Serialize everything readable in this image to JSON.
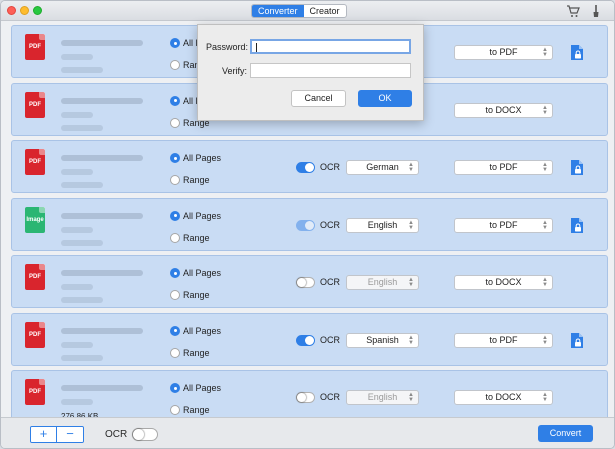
{
  "tabs": [
    {
      "label": "Converter",
      "active": true
    },
    {
      "label": "Creator",
      "active": false
    }
  ],
  "toolbar_icons": [
    "cart-icon",
    "brush-icon"
  ],
  "files": [
    {
      "type": "PDF",
      "size": "",
      "range_all": "All Pages",
      "range_custom": "Range",
      "ocr_visible": false,
      "ocr_on": false,
      "language": "",
      "output": "to PDF",
      "has_lock": true
    },
    {
      "type": "PDF",
      "size": "",
      "range_all": "All Pages",
      "range_custom": "Range",
      "ocr_visible": false,
      "ocr_on": false,
      "language": "",
      "output": "to DOCX",
      "has_lock": false
    },
    {
      "type": "PDF",
      "size": "",
      "range_all": "All Pages",
      "range_custom": "Range",
      "ocr_visible": true,
      "ocr_on": true,
      "language": "German",
      "output": "to PDF",
      "has_lock": true
    },
    {
      "type": "Image",
      "size": "",
      "range_all": "All Pages",
      "range_custom": "Range",
      "ocr_visible": true,
      "ocr_on": true,
      "ocr_dim": true,
      "language": "English",
      "output": "to PDF",
      "has_lock": true
    },
    {
      "type": "PDF",
      "size": "",
      "range_all": "All Pages",
      "range_custom": "Range",
      "ocr_visible": true,
      "ocr_on": false,
      "language": "English",
      "language_disabled": true,
      "output": "to DOCX",
      "has_lock": false
    },
    {
      "type": "PDF",
      "size": "",
      "range_all": "All Pages",
      "range_custom": "Range",
      "ocr_visible": true,
      "ocr_on": true,
      "language": "Spanish",
      "output": "to PDF",
      "has_lock": true
    },
    {
      "type": "PDF",
      "size": "276.86 KB",
      "range_all": "All Pages",
      "range_custom": "Range",
      "ocr_visible": true,
      "ocr_on": false,
      "language": "English",
      "language_disabled": true,
      "output": "to DOCX",
      "has_lock": false
    }
  ],
  "ocr_label": "OCR",
  "bottom": {
    "add": "+",
    "remove": "−",
    "ocr_label": "OCR",
    "ocr_on": false,
    "convert_label": "Convert"
  },
  "dialog": {
    "password_label": "Password:",
    "verify_label": "Verify:",
    "password_value": "",
    "verify_value": "",
    "cancel_label": "Cancel",
    "ok_label": "OK"
  },
  "colors": {
    "accent": "#2f7fe6",
    "row_bg": "#c9dcf4",
    "pdf_icon": "#d9252d",
    "image_icon": "#2bb673"
  }
}
